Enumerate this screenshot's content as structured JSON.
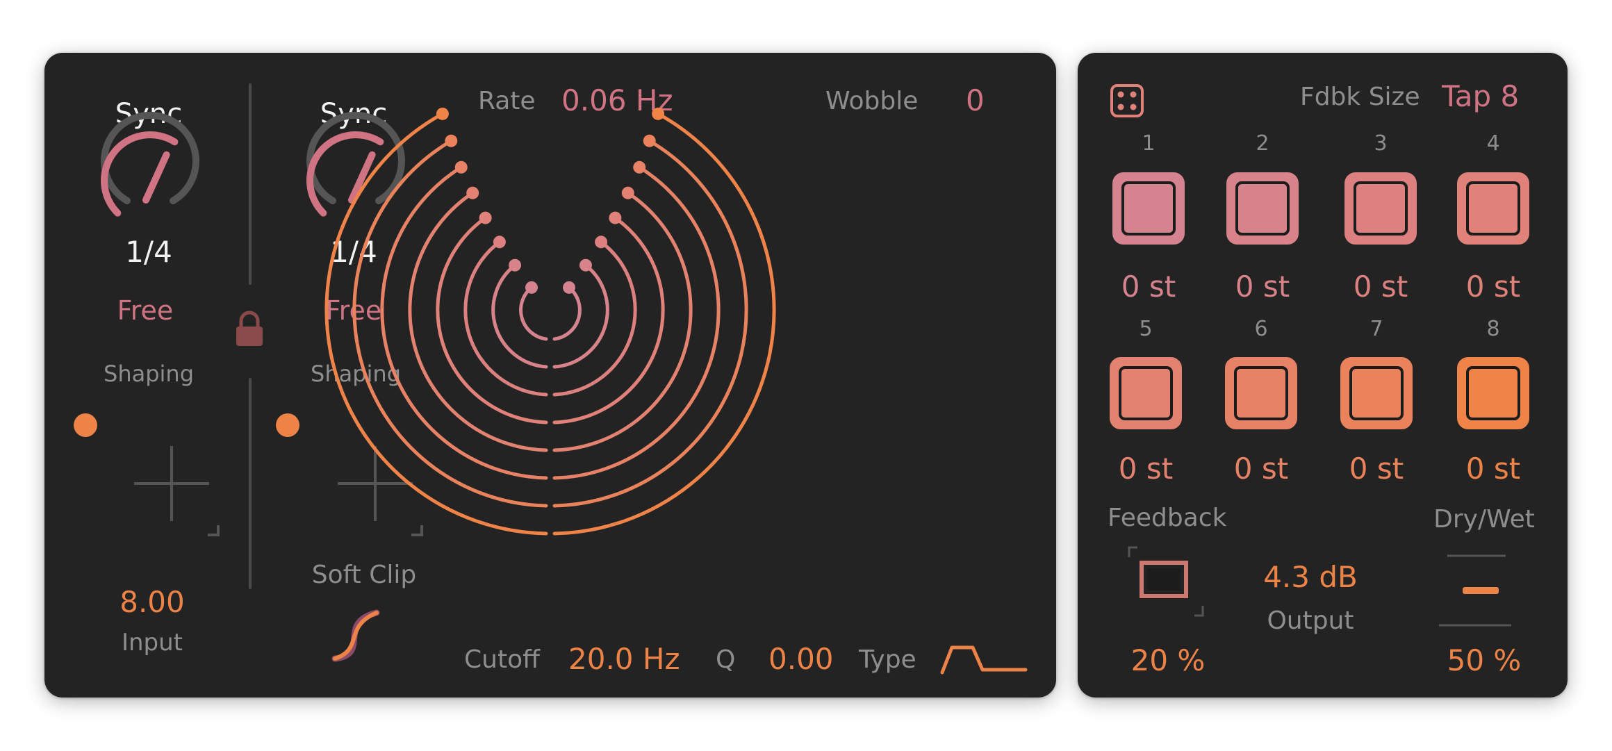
{
  "colors": {
    "panel": "#232323",
    "pink": "#d07484",
    "orange": "#ee8347",
    "gray_text": "#8e8e8e",
    "white_text": "#f2f2f2",
    "knob_track": "#555555"
  },
  "lfo_left": {
    "sync_label": "Sync",
    "division": "1/4",
    "mode": "Free",
    "shaping_label": "Shaping",
    "knob_value_fraction": 0.62
  },
  "lfo_right": {
    "sync_label": "Sync",
    "division": "1/4",
    "mode": "Free",
    "shaping_label": "Shaping",
    "knob_value_fraction": 0.62
  },
  "lock_icon": "lock-icon",
  "input": {
    "value": "8.00",
    "label": "Input"
  },
  "soft_clip": {
    "label": "Soft Clip",
    "icon": "s-curve-icon"
  },
  "modulation": {
    "rate_label": "Rate",
    "rate_value": "0.06 Hz",
    "wobble_label": "Wobble",
    "wobble_value": "0"
  },
  "filter": {
    "cutoff_label": "Cutoff",
    "cutoff_value": "20.0 Hz",
    "q_label": "Q",
    "q_value": "0.00",
    "type_label": "Type",
    "type_icon": "bandpass-filter-icon"
  },
  "delay": {
    "random_icon": "dice-icon",
    "fdbk_size_label": "Fdbk Size",
    "fdbk_size_value": "Tap 8",
    "taps": [
      {
        "number": "1",
        "value": "0 st",
        "color": "#d4838f"
      },
      {
        "number": "2",
        "value": "0 st",
        "color": "#d8828a"
      },
      {
        "number": "3",
        "value": "0 st",
        "color": "#dc8180"
      },
      {
        "number": "4",
        "value": "0 st",
        "color": "#e0827a"
      },
      {
        "number": "5",
        "value": "0 st",
        "color": "#e38270"
      },
      {
        "number": "6",
        "value": "0 st",
        "color": "#e78267"
      },
      {
        "number": "7",
        "value": "0 st",
        "color": "#ea835b"
      },
      {
        "number": "8",
        "value": "0 st",
        "color": "#ef8348"
      }
    ],
    "feedback_label": "Feedback",
    "feedback_value": "20 %",
    "output_value": "4.3 dB",
    "output_label": "Output",
    "dry_wet_label": "Dry/Wet",
    "dry_wet_value": "50 %",
    "dry_wet_fraction": 0.5
  }
}
